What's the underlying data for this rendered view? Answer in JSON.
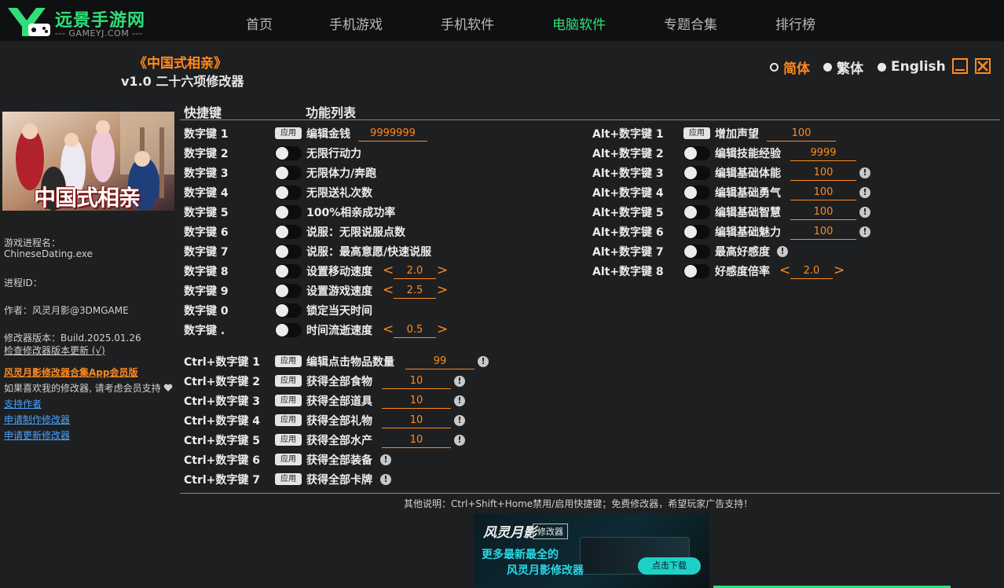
{
  "site": {
    "logo_text": "远景手游网",
    "logo_sub": "--- GAMEYJ.COM ---",
    "nav": [
      "首页",
      "手机游戏",
      "手机软件",
      "电脑软件",
      "专题合集",
      "排行榜"
    ],
    "active_nav": "电脑软件",
    "accent_color": "#2fe07a"
  },
  "trainer": {
    "title": "《中国式相亲》",
    "version": "v1.0 二十六项修改器",
    "languages": [
      "简体",
      "繁体",
      "English"
    ],
    "selected_language": "简体",
    "accent_color": "#ff8a1f"
  },
  "cover": {
    "title_art": "中国式相亲"
  },
  "sidebar": {
    "process_name_label": "游戏进程名：",
    "process_name": "ChineseDating.exe",
    "process_id_label": "进程ID：",
    "author": "作者：风灵月影@3DMGAME",
    "trainer_version": "修改器版本：Build.2025.01.26",
    "check_update": "检查修改器版本更新 (√)",
    "promo": "风灵月影修改器合集App会员版",
    "support_text": "如果喜欢我的修改器, 请考虑会员支持",
    "links": [
      "支持作者",
      "申请制作修改器",
      "申请更新修改器"
    ]
  },
  "table": {
    "col_hotkey": "快捷键",
    "col_features": "功能列表",
    "apply_label": "应用",
    "left": [
      {
        "key": "数字键 1",
        "name": "编辑金钱",
        "control": "apply",
        "value": "9999999"
      },
      {
        "key": "数字键 2",
        "name": "无限行动力",
        "control": "toggle"
      },
      {
        "key": "数字键 3",
        "name": "无限体力/奔跑",
        "control": "toggle"
      },
      {
        "key": "数字键 4",
        "name": "无限送礼次数",
        "control": "toggle"
      },
      {
        "key": "数字键 5",
        "name": "100%相亲成功率",
        "control": "toggle"
      },
      {
        "key": "数字键 6",
        "name": "说服：无限说服点数",
        "control": "toggle"
      },
      {
        "key": "数字键 7",
        "name": "说服：最高意愿/快速说服",
        "control": "toggle"
      },
      {
        "key": "数字键 8",
        "name": "设置移动速度",
        "control": "toggle",
        "value": "2.0"
      },
      {
        "key": "数字键 9",
        "name": "设置游戏速度",
        "control": "toggle",
        "value": "2.5"
      },
      {
        "key": "数字键 0",
        "name": "锁定当天时间",
        "control": "toggle"
      },
      {
        "key": "数字键 .",
        "name": "时间流逝速度",
        "control": "toggle",
        "value": "0.5"
      }
    ],
    "ctrl": [
      {
        "key": "Ctrl+数字键 1",
        "name": "编辑点击物品数量",
        "value": "99"
      },
      {
        "key": "Ctrl+数字键 2",
        "name": "获得全部食物",
        "value": "10"
      },
      {
        "key": "Ctrl+数字键 3",
        "name": "获得全部道具",
        "value": "10"
      },
      {
        "key": "Ctrl+数字键 4",
        "name": "获得全部礼物",
        "value": "10"
      },
      {
        "key": "Ctrl+数字键 5",
        "name": "获得全部水产",
        "value": "10"
      },
      {
        "key": "Ctrl+数字键 6",
        "name": "获得全部装备"
      },
      {
        "key": "Ctrl+数字键 7",
        "name": "获得全部卡牌"
      }
    ],
    "alt": [
      {
        "key": "Alt+数字键 1",
        "name": "增加声望",
        "control": "apply",
        "value": "100"
      },
      {
        "key": "Alt+数字键 2",
        "name": "编辑技能经验",
        "control": "toggle",
        "value": "9999"
      },
      {
        "key": "Alt+数字键 3",
        "name": "编辑基础体能",
        "control": "toggle",
        "value": "100"
      },
      {
        "key": "Alt+数字键 4",
        "name": "编辑基础勇气",
        "control": "toggle",
        "value": "100"
      },
      {
        "key": "Alt+数字键 5",
        "name": "编辑基础智慧",
        "control": "toggle",
        "value": "100"
      },
      {
        "key": "Alt+数字键 6",
        "name": "编辑基础魅力",
        "control": "toggle",
        "value": "100"
      },
      {
        "key": "Alt+数字键 7",
        "name": "最高好感度",
        "control": "toggle"
      },
      {
        "key": "Alt+数字键 8",
        "name": "好感度倍率",
        "control": "toggle",
        "value": "2.0"
      }
    ],
    "warn_glyph": "!",
    "arrow_left": "<",
    "arrow_right": ">"
  },
  "footer": {
    "note": "其他说明：Ctrl+Shift+Home禁用/启用快捷键；免费修改器，希望玩家广告支持！"
  },
  "banner": {
    "logo": "风灵月影",
    "tag": "修改器",
    "line1": "更多最新最全的",
    "line2": "风灵月影修改器",
    "button": "点击下载"
  }
}
